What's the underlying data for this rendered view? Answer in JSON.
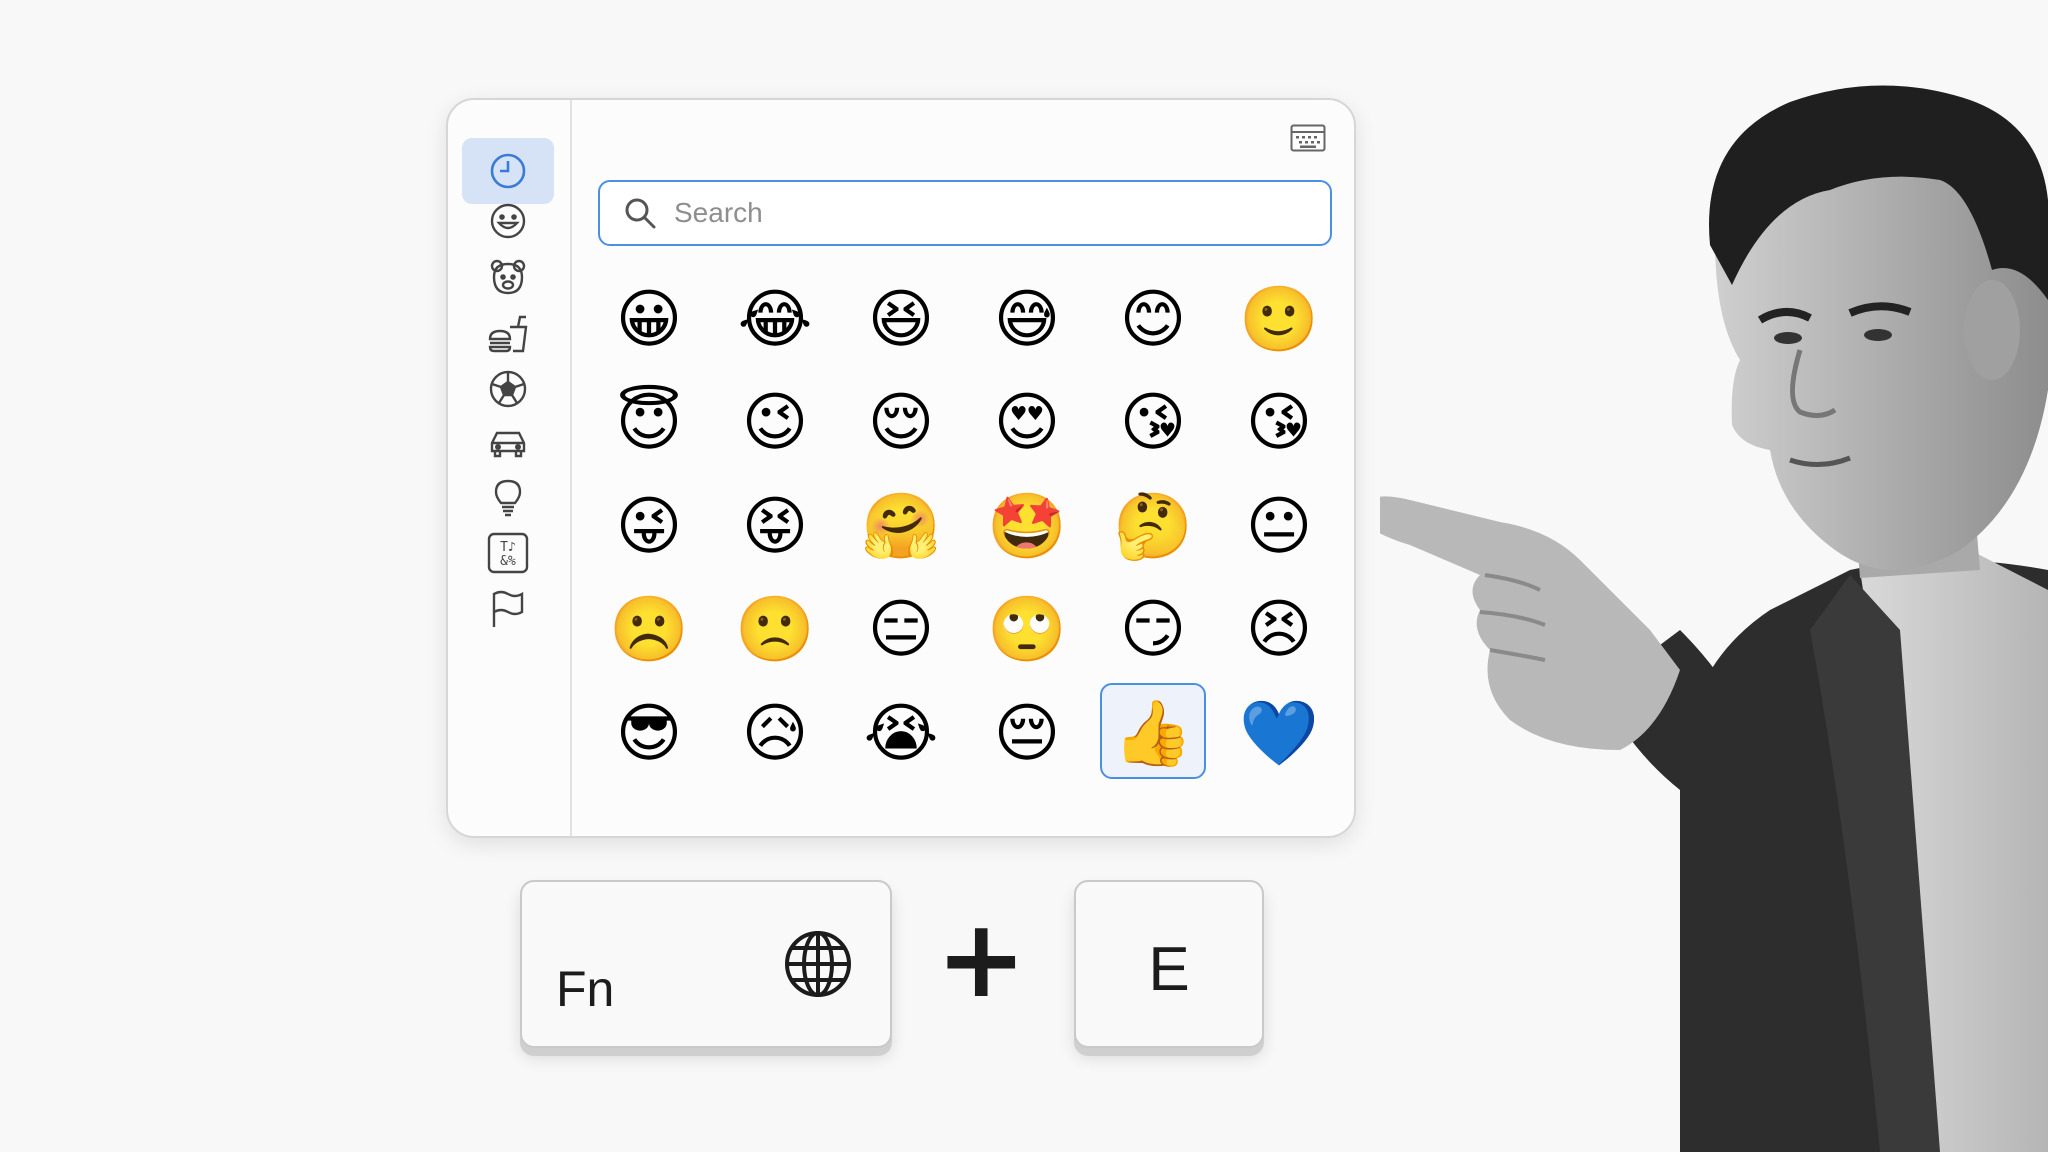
{
  "search": {
    "placeholder": "Search",
    "value": ""
  },
  "categories": [
    {
      "name": "frequently-used",
      "active": true
    },
    {
      "name": "smileys-people",
      "active": false
    },
    {
      "name": "animals-nature",
      "active": false
    },
    {
      "name": "food-drink",
      "active": false
    },
    {
      "name": "activity",
      "active": false
    },
    {
      "name": "travel-places",
      "active": false
    },
    {
      "name": "objects",
      "active": false
    },
    {
      "name": "symbols",
      "active": false
    },
    {
      "name": "flags",
      "active": false
    }
  ],
  "emoji_grid": [
    [
      "😀",
      "😂",
      "😆",
      "😅",
      "😊",
      "🙂"
    ],
    [
      "😇",
      "😉",
      "😌",
      "😍",
      "😘",
      "😘"
    ],
    [
      "😜",
      "😝",
      "🤗",
      "🤩",
      "🤔",
      "😐"
    ],
    [
      "☹️",
      "🙁",
      "😑",
      "🙄",
      "😏",
      "😣"
    ],
    [
      "😎",
      "😥",
      "😭",
      "😔",
      "👍",
      "💙"
    ]
  ],
  "selected_emoji": "👍",
  "symbols_icon_text": [
    "T♪",
    "&%"
  ],
  "shortcut": {
    "key1": "Fn",
    "plus": "+",
    "key2": "E"
  },
  "colors": {
    "accent": "#4a90e2",
    "active_category_bg": "#d6e3f6"
  }
}
